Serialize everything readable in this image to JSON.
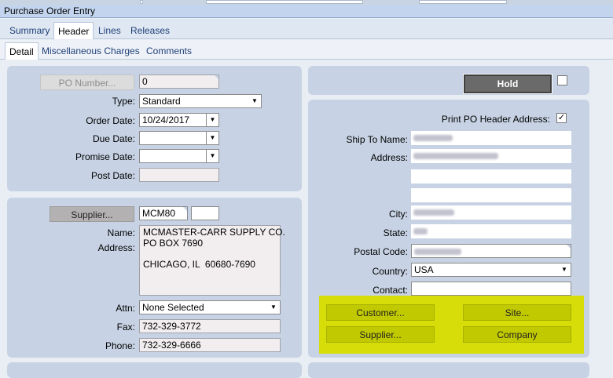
{
  "window": {
    "title": "Purchase Order Entry"
  },
  "tabs_primary": [
    {
      "label": "Summary",
      "active": false
    },
    {
      "label": "Header",
      "active": true
    },
    {
      "label": "Lines",
      "active": false
    },
    {
      "label": "Releases",
      "active": false
    }
  ],
  "tabs_secondary": [
    {
      "label": "Detail",
      "active": true
    },
    {
      "label": "Miscellaneous Charges",
      "active": false
    },
    {
      "label": "Comments",
      "active": false
    }
  ],
  "po": {
    "po_number_button": "PO Number...",
    "po_number_value": "0",
    "type_label": "Type:",
    "type_value": "Standard",
    "order_date_label": "Order Date:",
    "order_date_value": "10/24/2017",
    "due_date_label": "Due Date:",
    "due_date_value": "",
    "promise_date_label": "Promise Date:",
    "promise_date_value": "",
    "post_date_label": "Post Date:",
    "post_date_value": ""
  },
  "supplier": {
    "button": "Supplier...",
    "code": "MCM80",
    "code2": "",
    "name_label": "Name:",
    "address_label": "Address:",
    "address_text": "MCMASTER-CARR SUPPLY CO.\nPO BOX 7690\n\nCHICAGO, IL  60680-7690",
    "attn_label": "Attn:",
    "attn_value": "None Selected",
    "fax_label": "Fax:",
    "fax_value": "732-329-3772",
    "phone_label": "Phone:",
    "phone_value": "732-329-6666"
  },
  "hold": {
    "label": "Hold",
    "checked": false
  },
  "ship_to": {
    "print_header_label": "Print PO Header Address:",
    "print_header_checked": true,
    "ship_to_name_label": "Ship To Name:",
    "address_label": "Address:",
    "city_label": "City:",
    "state_label": "State:",
    "postal_code_label": "Postal Code:",
    "country_label": "Country:",
    "country_value": "USA",
    "contact_label": "Contact:",
    "contact_value": ""
  },
  "action_buttons": {
    "customer": "Customer...",
    "site": "Site...",
    "supplier": "Supplier...",
    "company": "Company"
  },
  "colors": {
    "panel": "#c7d3e4",
    "highlight": "#d6dd08",
    "hold_button": "#6a6a6a"
  }
}
